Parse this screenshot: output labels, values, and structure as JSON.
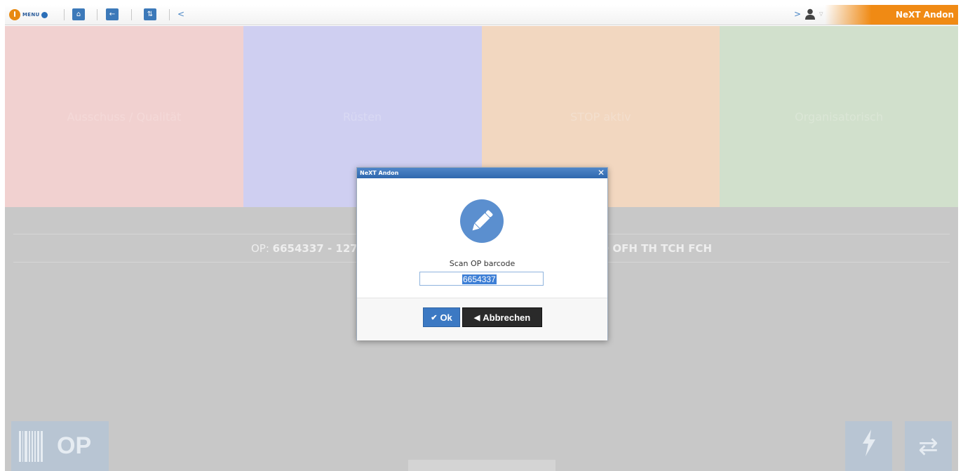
{
  "toolbar": {
    "menu_label": "MENU",
    "brand": "NeXT Andon",
    "nav_arrow_left": "<",
    "nav_arrow_right": ">"
  },
  "tiles": [
    {
      "label": "Ausschuss / Qualität",
      "color": "#f1d1d0"
    },
    {
      "label": "Rüsten",
      "color": "#cfcff1"
    },
    {
      "label": "STOP aktiv",
      "color": "#f2d7c0"
    },
    {
      "label": "Organisatorisch",
      "color": "#d1e0cc"
    }
  ],
  "op_info": {
    "prefix": "OP:",
    "number": "6654337 - 127",
    "suffix": "D OFH TH TCH FCH"
  },
  "op_button": {
    "label": "OP"
  },
  "dialog": {
    "title": "NeXT Andon",
    "close": "✕",
    "prompt": "Scan OP barcode",
    "input_value": "6654337",
    "ok_label": "Ok",
    "cancel_label": "Abbrechen"
  },
  "icons": {
    "power": "power-icon",
    "home": "home-icon",
    "back": "arrow-left-icon",
    "swap": "swap-icon",
    "user": "user-icon",
    "pencil": "pencil-icon",
    "barcode": "barcode-icon",
    "lightning": "lightning-icon",
    "refresh": "refresh-icon"
  },
  "colors": {
    "accent": "#3c79b9",
    "brand": "#f08a14",
    "overlay": "#c8c8c8"
  }
}
